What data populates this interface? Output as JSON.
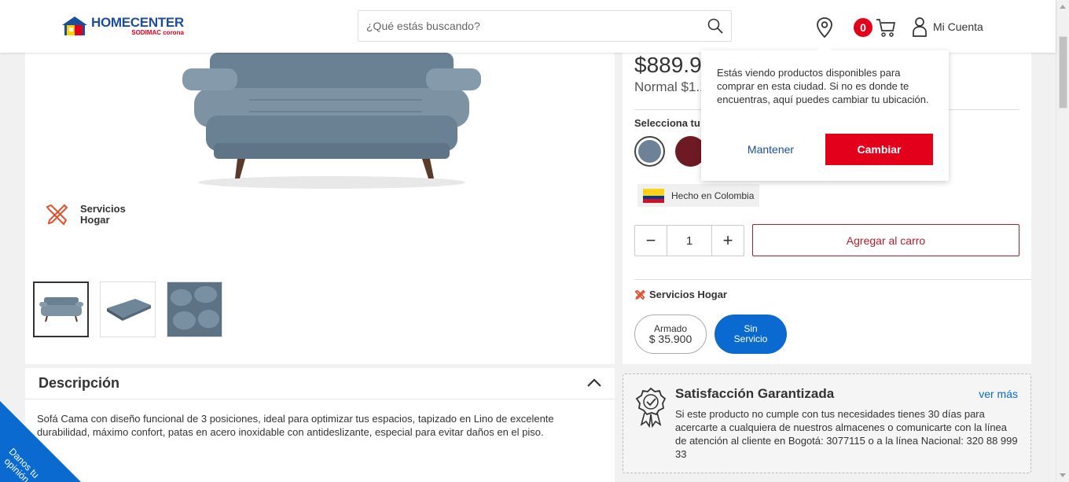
{
  "header": {
    "logo_main": "HOMECENTER",
    "logo_sub": "SODIMAC corona",
    "search_placeholder": "¿Qué estás buscando?",
    "cart_count": "0",
    "account_label": "Mi Cuenta"
  },
  "gallery": {
    "services_label_line1": "Servicios",
    "services_label_line2": "Hogar"
  },
  "description": {
    "title": "Descripción",
    "body": "Sofá Cama con diseño funcional de 3 posiciones, ideal para optimizar tus espacios, tapizado en Lino de excelente durabilidad, máximo confort, patas en acero inoxidable con antideslizante, especial para evitar daños en el piso."
  },
  "product": {
    "price": "$889.9",
    "normal_price": "Normal $1.1",
    "select_label": "Selecciona tu",
    "made_in": "Hecho en Colombia",
    "quantity": "1",
    "add_to_cart": "Agregar al carro",
    "services_title": "Servicios Hogar",
    "service_option1_name": "Armado",
    "service_option1_price": "$ 35.900",
    "service_option2_line1": "Sin",
    "service_option2_line2": "Servicio",
    "colors": [
      "#6d8296",
      "#6e1a24"
    ]
  },
  "guarantee": {
    "title": "Satisfacción Garantizada",
    "more_link": "ver más",
    "body": "Si este producto no cumple con tus necesidades tienes 30 días para acercarte a cualquiera de nuestros almacenes o comunicarte con la línea de atención al cliente en Bogotá: 3077115 o a la línea Nacional: 320 88 999 33"
  },
  "location_popup": {
    "message": "Estás viendo productos disponibles para comprar en esta ciudad. Si no es donde te encuentras, aquí puedes cambiar tu ubicación.",
    "keep_label": "Mantener",
    "change_label": "Cambiar"
  },
  "feedback": {
    "line1": "Danos tu",
    "line2": "opinión"
  },
  "theme": {
    "brand_blue": "#1b4f9c",
    "brand_red": "#e3001b",
    "link_blue": "#0a6ad0"
  }
}
